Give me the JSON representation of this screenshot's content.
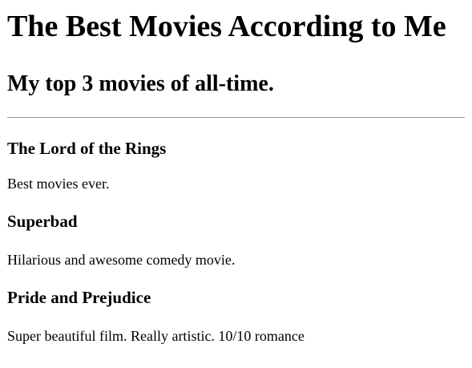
{
  "page": {
    "heading": "The Best Movies According to Me",
    "subheading": "My top 3 movies of all-time."
  },
  "movies": [
    {
      "title": "The Lord of the Rings",
      "description": "Best movies ever."
    },
    {
      "title": "Superbad",
      "description": "Hilarious and awesome comedy movie."
    },
    {
      "title": "Pride and Prejudice",
      "description": "Super beautiful film. Really artistic. 10/10 romance"
    }
  ]
}
